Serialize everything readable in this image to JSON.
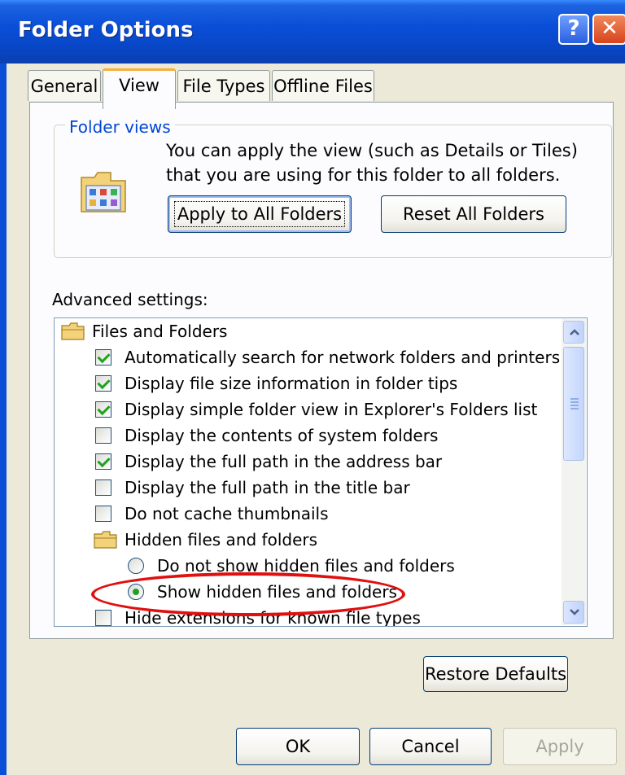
{
  "window": {
    "title": "Folder Options",
    "help_glyph": "?",
    "close_glyph": "✕"
  },
  "tabs": [
    {
      "label": "General"
    },
    {
      "label": "View",
      "active": true
    },
    {
      "label": "File Types"
    },
    {
      "label": "Offline Files"
    }
  ],
  "folder_views": {
    "label": "Folder views",
    "description": "You can apply the view (such as Details or Tiles) that you are using for this folder to all folders.",
    "apply_button": "Apply to All Folders",
    "reset_button": "Reset All Folders"
  },
  "advanced": {
    "label": "Advanced settings:",
    "items": [
      {
        "type": "folder",
        "label": "Files and Folders"
      },
      {
        "type": "checkbox",
        "label": "Automatically search for network folders and printers",
        "checked": true
      },
      {
        "type": "checkbox",
        "label": "Display file size information in folder tips",
        "checked": true
      },
      {
        "type": "checkbox",
        "label": "Display simple folder view in Explorer's Folders list",
        "checked": true
      },
      {
        "type": "checkbox",
        "label": "Display the contents of system folders",
        "checked": false
      },
      {
        "type": "checkbox",
        "label": "Display the full path in the address bar",
        "checked": true
      },
      {
        "type": "checkbox",
        "label": "Display the full path in the title bar",
        "checked": false
      },
      {
        "type": "checkbox",
        "label": "Do not cache thumbnails",
        "checked": false
      },
      {
        "type": "folder",
        "label": "Hidden files and folders"
      },
      {
        "type": "radio",
        "label": "Do not show hidden files and folders",
        "checked": false
      },
      {
        "type": "radio",
        "label": "Show hidden files and folders",
        "checked": true
      },
      {
        "type": "checkbox",
        "label": "Hide extensions for known file types",
        "checked": false
      }
    ]
  },
  "restore_button": "Restore Defaults",
  "footer": {
    "ok": "OK",
    "cancel": "Cancel",
    "apply": "Apply"
  },
  "colors": {
    "titlebar": "#0a4fd8",
    "annotation": "#e01010",
    "check": "#21a121",
    "dialog_bg": "#ece9d8"
  }
}
